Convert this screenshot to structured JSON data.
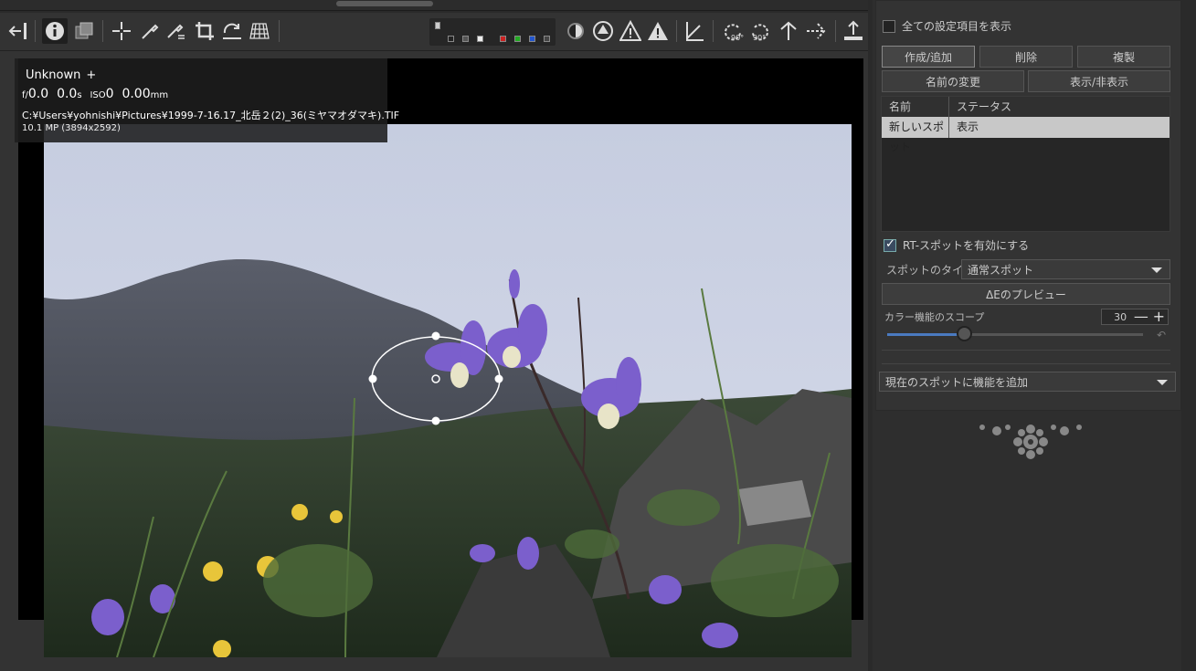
{
  "info_overlay": {
    "lens": "Unknown",
    "plus": "+",
    "f_prefix": "f/",
    "aperture": "0.0",
    "shutter": "0.0",
    "shutter_unit": "s",
    "iso_prefix": "ISO",
    "iso": "0",
    "focal": "0.00",
    "focal_unit": "mm",
    "file_path": "C:¥Users¥yohnishi¥Pictures¥1999-7-16.17_北岳２(2)_36(ミヤマオダマキ).TIF",
    "megapixels": "10.1 MP (3894x2592)"
  },
  "toolbar": {
    "icons": [
      "hide-panel-icon",
      "info-icon",
      "before-after-icon",
      "straighten-icon",
      "color-picker-icon",
      "white-balance-picker-icon",
      "crop-icon",
      "rotate-icon",
      "perspective-icon",
      "focus-mask-icon",
      "exposure-clip-icon",
      "warning-shadow-icon",
      "warning-highlight-icon",
      "angle-icon",
      "rotate-left-icon",
      "rotate-right-icon",
      "flip-vertical-icon",
      "flip-horizontal-icon",
      "export-icon"
    ],
    "swatch_colors": [
      "#222222",
      "#555555",
      "#eeeeee",
      "#cc2222",
      "#22aa22",
      "#2255cc",
      "#444444"
    ]
  },
  "panel": {
    "show_all_label": "全ての設定項目を表示",
    "buttons": {
      "create": "作成/追加",
      "delete": "削除",
      "duplicate": "複製",
      "rename": "名前の変更",
      "show_hide": "表示/非表示"
    },
    "table": {
      "col_name": "名前",
      "col_status": "ステータス",
      "rows": [
        {
          "name": "新しいスポット",
          "status": "表示"
        }
      ]
    },
    "rt_spot_label": "RT-スポットを有効にする",
    "spot_type_label": "スポットのタイプ:",
    "spot_type_value": "通常スポット",
    "preview_button": "ΔEのプレビュー",
    "scope_label": "カラー機能のスコープ",
    "scope_value": "30",
    "scope_fraction": 0.3,
    "add_tool_label": "現在のスポットに機能を追加"
  }
}
